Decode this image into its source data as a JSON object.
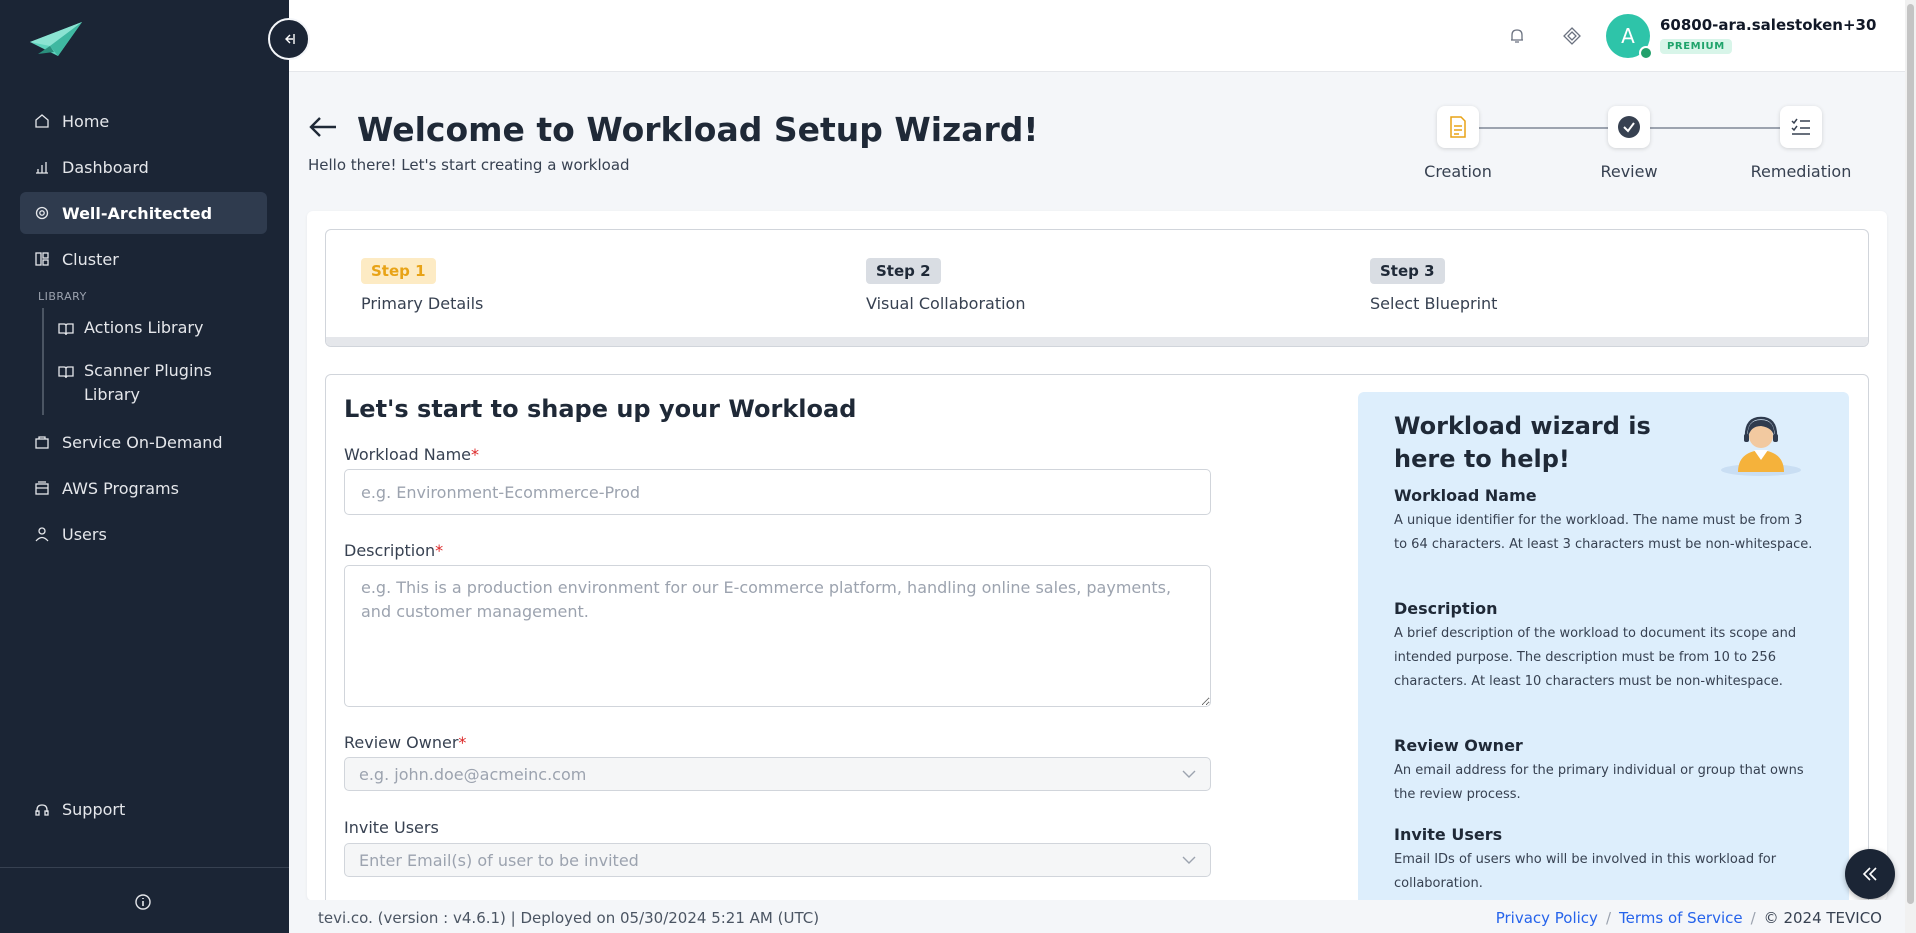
{
  "sidebar": {
    "items": [
      {
        "label": "Home",
        "icon": "home-icon"
      },
      {
        "label": "Dashboard",
        "icon": "bar-chart-icon"
      },
      {
        "label": "Well-Architected",
        "icon": "gear-icon"
      },
      {
        "label": "Cluster",
        "icon": "cluster-icon"
      }
    ],
    "library_label": "LIBRARY",
    "library_items": [
      {
        "label": "Actions Library",
        "icon": "book-icon"
      },
      {
        "label": "Scanner Plugins Library",
        "icon": "book-icon"
      }
    ],
    "bottom_items": [
      {
        "label": "Service On-Demand",
        "icon": "bag-icon"
      },
      {
        "label": "AWS Programs",
        "icon": "programs-icon"
      },
      {
        "label": "Users",
        "icon": "user-icon"
      }
    ],
    "support_label": "Support"
  },
  "header": {
    "avatar_letter": "A",
    "user_name": "60800-ara.salestoken+30",
    "plan_badge": "PREMIUM"
  },
  "page": {
    "title": "Welcome to Workload Setup Wizard!",
    "subtitle": "Hello there! Let's start creating a workload"
  },
  "stepper": [
    {
      "label": "Creation"
    },
    {
      "label": "Review"
    },
    {
      "label": "Remediation"
    }
  ],
  "wizard_steps": [
    {
      "badge": "Step 1",
      "name": "Primary Details"
    },
    {
      "badge": "Step 2",
      "name": "Visual Collaboration"
    },
    {
      "badge": "Step 3",
      "name": "Select Blueprint"
    }
  ],
  "form": {
    "title": "Let's start to shape up your Workload",
    "workload_name": {
      "label": "Workload Name",
      "required": "*",
      "placeholder": "e.g. Environment-Ecommerce-Prod",
      "value": ""
    },
    "description": {
      "label": "Description",
      "required": "*",
      "placeholder": "e.g. This is a production environment for our E-commerce platform, handling online sales, payments, and customer management.",
      "value": ""
    },
    "review_owner": {
      "label": "Review Owner",
      "required": "*",
      "placeholder": "e.g. john.doe@acmeinc.com"
    },
    "invite_users": {
      "label": "Invite Users",
      "placeholder": "Enter Email(s) of user to be invited"
    }
  },
  "help": {
    "title": "Workload wizard is here to help!",
    "sections": [
      {
        "heading": "Workload Name",
        "text": "A unique identifier for the workload. The name must be from 3 to 64 characters. At least 3 characters must be non-whitespace."
      },
      {
        "heading": "Description",
        "text": "A brief description of the workload to document its scope and intended purpose. The description must be from 10 to 256 characters. At least 10 characters must be non-whitespace."
      },
      {
        "heading": "Review Owner",
        "text": "An email address for the primary individual or group that owns the review process."
      },
      {
        "heading": "Invite Users",
        "text": "Email IDs of users who will be involved in this workload for collaboration."
      }
    ]
  },
  "footer": {
    "version_text": "tevi.co. (version : v4.6.1) | Deployed on 05/30/2024 5:21 AM (UTC)",
    "privacy": "Privacy Policy",
    "terms": "Terms of Service",
    "copyright": "© 2024 TEVICO"
  },
  "colors": {
    "sidebar_bg": "#1b2535",
    "accent_teal": "#2ec4a9",
    "step_active": "#e8a317",
    "link": "#2563eb",
    "help_bg": "#ddeefc"
  }
}
